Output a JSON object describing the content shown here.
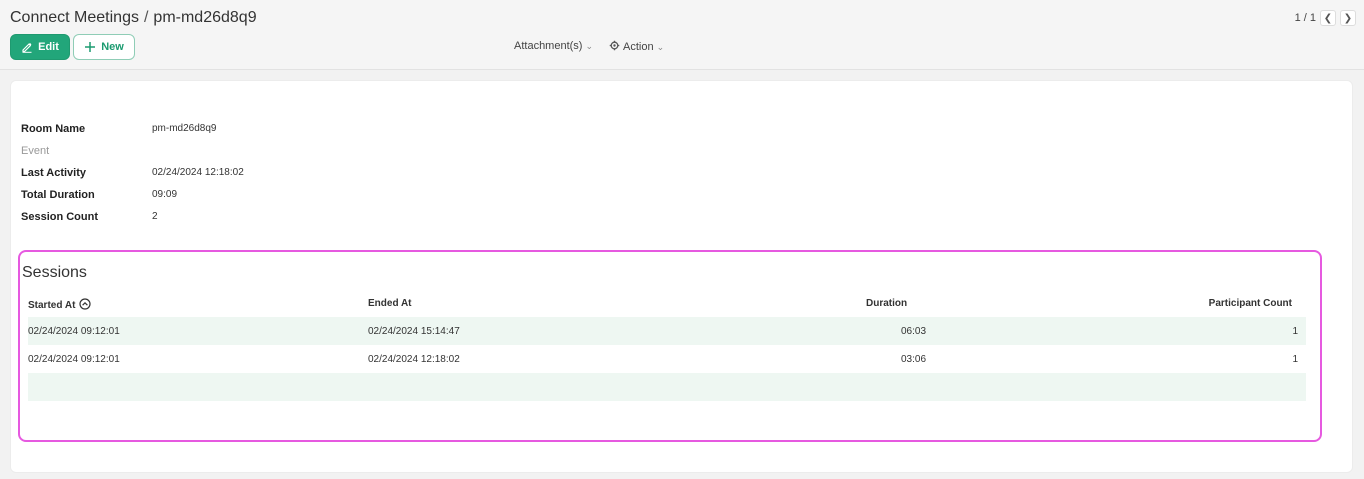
{
  "header": {
    "breadcrumb_parent": "Connect Meetings",
    "breadcrumb_sep": "/",
    "record_name": "pm-md26d8q9",
    "edit_label": "Edit",
    "new_label": "New",
    "attachments_label": "Attachment(s)",
    "action_label": "Action",
    "pager_text": "1 / 1"
  },
  "fields": {
    "room_name_label": "Room Name",
    "room_name_value": "pm-md26d8q9",
    "event_label": "Event",
    "last_activity_label": "Last Activity",
    "last_activity_value": "02/24/2024 12:18:02",
    "total_duration_label": "Total Duration",
    "total_duration_value": "09:09",
    "session_count_label": "Session Count",
    "session_count_value": "2"
  },
  "sessions": {
    "title": "Sessions",
    "columns": {
      "started_at": "Started At",
      "ended_at": "Ended At",
      "duration": "Duration",
      "participant_count": "Participant Count"
    },
    "rows": [
      {
        "started_at": "02/24/2024 09:12:01",
        "ended_at": "02/24/2024 15:14:47",
        "duration": "06:03",
        "participant_count": "1"
      },
      {
        "started_at": "02/24/2024 09:12:01",
        "ended_at": "02/24/2024 12:18:02",
        "duration": "03:06",
        "participant_count": "1"
      }
    ]
  },
  "colors": {
    "primary": "#22a67a",
    "highlight": "#e659e0",
    "row_alt": "#eef7f2"
  }
}
